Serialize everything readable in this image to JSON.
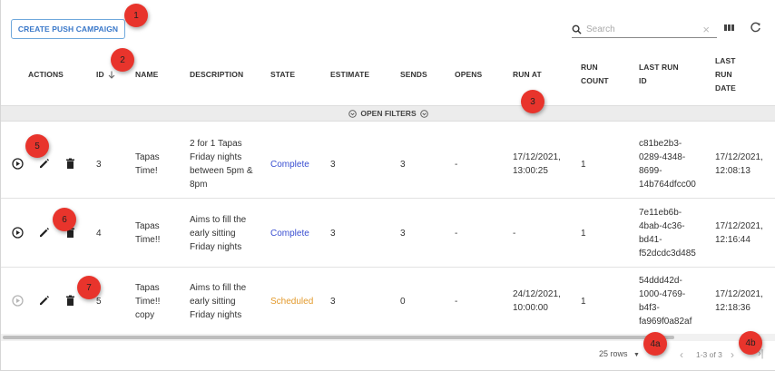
{
  "toolbar": {
    "create_label": "CREATE PUSH CAMPAIGN",
    "search_placeholder": "Search",
    "search_value": ""
  },
  "columns": {
    "actions": "ACTIONS",
    "id": "ID",
    "name": "NAME",
    "description": "DESCRIPTION",
    "state": "STATE",
    "estimate": "ESTIMATE",
    "sends": "SENDS",
    "opens": "OPENS",
    "run_at": "RUN AT",
    "run_count_1": "RUN",
    "run_count_2": "COUNT",
    "last_run_id_1": "LAST RUN",
    "last_run_id_2": "ID",
    "last_run_date_1": "LAST",
    "last_run_date_2": "RUN",
    "last_run_date_3": "DATE"
  },
  "filters": {
    "label": "OPEN FILTERS"
  },
  "rows": [
    {
      "id": "3",
      "name": [
        "Tapas",
        "Time!"
      ],
      "description": [
        "2 for 1 Tapas",
        "Friday nights",
        "between 5pm &",
        "8pm"
      ],
      "state": "Complete",
      "estimate": "3",
      "sends": "3",
      "opens": "-",
      "run_at": [
        "17/12/2021,",
        "13:00:25"
      ],
      "run_count": "1",
      "last_run_id": [
        "c81be2b3-",
        "0289-4348-",
        "8699-",
        "14b764dfcc00"
      ],
      "last_run_date": [
        "17/12/2021,",
        "12:08:13"
      ]
    },
    {
      "id": "4",
      "name": [
        "Tapas",
        "Time!!"
      ],
      "description": [
        "Aims to fill the",
        "early sitting",
        "Friday nights"
      ],
      "state": "Complete",
      "estimate": "3",
      "sends": "3",
      "opens": "-",
      "run_at": [
        "-"
      ],
      "run_count": "1",
      "last_run_id": [
        "7e11eb6b-",
        "4bab-4c36-",
        "bd41-",
        "f52dcdc3d485"
      ],
      "last_run_date": [
        "17/12/2021,",
        "12:16:44"
      ]
    },
    {
      "id": "5",
      "name": [
        "Tapas",
        "Time!!",
        "copy"
      ],
      "description": [
        "Aims to fill the",
        "early sitting",
        "Friday nights"
      ],
      "state": "Scheduled",
      "estimate": "3",
      "sends": "0",
      "opens": "-",
      "run_at": [
        "24/12/2021,",
        "10:00:00"
      ],
      "run_count": "1",
      "last_run_id": [
        "54ddd42d-",
        "1000-4769-",
        "b4f3-",
        "fa969f0a82af"
      ],
      "last_run_date": [
        "17/12/2021,",
        "12:18:36"
      ]
    }
  ],
  "pagination": {
    "rows_per_page": "25 rows",
    "range": "1-3 of 3"
  },
  "annotations": {
    "b1": "1",
    "b2": "2",
    "b3": "3",
    "b4a": "4a",
    "b4b": "4b",
    "b5": "5",
    "b6": "6",
    "b7": "7"
  },
  "colors": {
    "complete": "#3a4fd1",
    "scheduled": "#e39a2c",
    "accent": "#3a78c9",
    "badge": "#e8342c"
  },
  "icons": {
    "search": "search-icon",
    "clear": "close-icon",
    "columns": "view-column-icon",
    "refresh": "refresh-icon",
    "play": "play-circle-icon",
    "edit": "pencil-icon",
    "delete": "trash-icon",
    "sort": "arrow-down-icon",
    "filter_chevron": "chevron-down-circle-icon"
  }
}
